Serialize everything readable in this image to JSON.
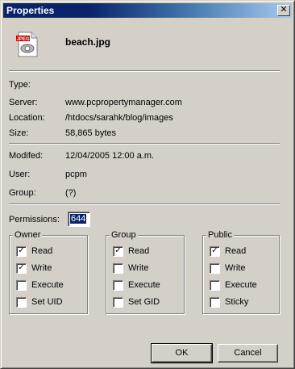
{
  "window": {
    "title": "Properties",
    "close_glyph": "✕"
  },
  "file": {
    "name": "beach.jpg",
    "icon_label": "JPEG",
    "icon": "jpeg-file-icon"
  },
  "fields": {
    "type": {
      "label": "Type:",
      "value": ""
    },
    "server": {
      "label": "Server:",
      "value": "www.pcpropertymanager.com"
    },
    "location": {
      "label": "Location:",
      "value": "/htdocs/sarahk/blog/images"
    },
    "size": {
      "label": "Size:",
      "value": "58,865 bytes"
    },
    "modified": {
      "label": "Modifed:",
      "value": "12/04/2005 12:00 a.m."
    },
    "user": {
      "label": "User:",
      "value": "pcpm"
    },
    "group": {
      "label": "Group:",
      "value": "(?)"
    }
  },
  "permissions": {
    "label": "Permissions:",
    "value": "644"
  },
  "groups": {
    "owner": {
      "title": "Owner",
      "items": [
        {
          "label": "Read",
          "checked": true
        },
        {
          "label": "Write",
          "checked": true
        },
        {
          "label": "Execute",
          "checked": false
        },
        {
          "label": "Set UID",
          "checked": false
        }
      ]
    },
    "group": {
      "title": "Group",
      "items": [
        {
          "label": "Read",
          "checked": true
        },
        {
          "label": "Write",
          "checked": false
        },
        {
          "label": "Execute",
          "checked": false
        },
        {
          "label": "Set GID",
          "checked": false
        }
      ]
    },
    "public": {
      "title": "Public",
      "items": [
        {
          "label": "Read",
          "checked": true
        },
        {
          "label": "Write",
          "checked": false
        },
        {
          "label": "Execute",
          "checked": false
        },
        {
          "label": "Sticky",
          "checked": false
        }
      ]
    }
  },
  "buttons": {
    "ok": "OK",
    "cancel": "Cancel"
  },
  "check_glyph": "✓",
  "colors": {
    "titlebar_start": "#0a246a",
    "titlebar_end": "#a6caf0",
    "face": "#d4d0c8",
    "selection": "#0a246a"
  }
}
